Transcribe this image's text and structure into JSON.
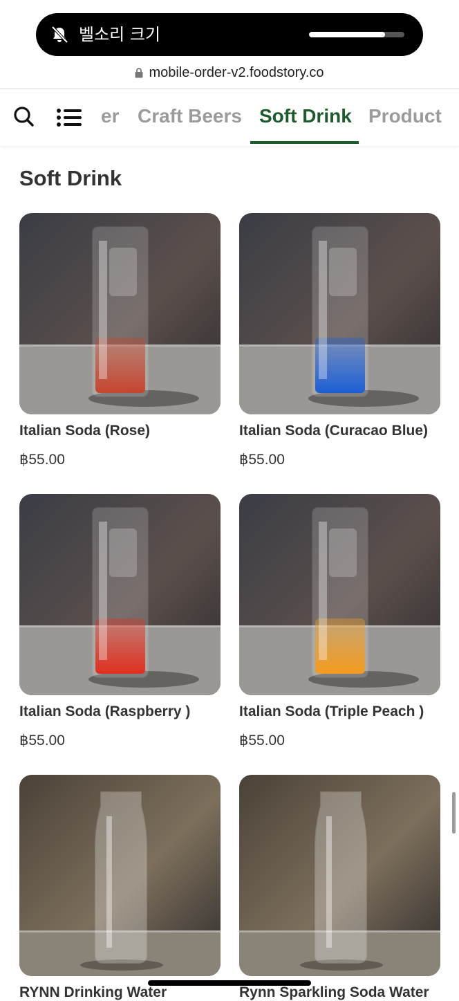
{
  "status_pill": {
    "text": "벨소리 크기",
    "volume_level": 0.8
  },
  "browser": {
    "url": "mobile-order-v2.foodstory.co"
  },
  "nav": {
    "tabs": [
      {
        "label": "er",
        "active": false
      },
      {
        "label": "Craft Beers",
        "active": false
      },
      {
        "label": "Soft Drink",
        "active": true
      },
      {
        "label": "Product",
        "active": false
      }
    ]
  },
  "section": {
    "title": "Soft Drink"
  },
  "products": [
    {
      "name": "Italian Soda (Rose)",
      "price": "฿55.00",
      "liquid_color": "#c6452e",
      "image": "italian-soda-rose-photo"
    },
    {
      "name": "Italian Soda (Curacao Blue)",
      "price": "฿55.00",
      "liquid_color": "#1d5fd6",
      "image": "italian-soda-curacao-blue-photo"
    },
    {
      "name": "Italian Soda (Raspberry )",
      "price": "฿55.00",
      "liquid_color": "#e0301f",
      "image": "italian-soda-raspberry-photo"
    },
    {
      "name": "Italian Soda (Triple Peach )",
      "price": "฿55.00",
      "liquid_color": "#f39c1f",
      "image": "italian-soda-triple-peach-photo"
    },
    {
      "name": "RYNN Drinking Water",
      "price": "",
      "liquid_color": "#d8d8d8",
      "image": "rynn-drinking-water-photo"
    },
    {
      "name": "Rynn Sparkling Soda Water",
      "price": "",
      "liquid_color": "#d8d8d8",
      "image": "rynn-sparkling-soda-water-photo"
    }
  ],
  "colors": {
    "accent": "#1d5a2c",
    "inactive_tab": "#9b9b9b",
    "text": "#333333"
  }
}
